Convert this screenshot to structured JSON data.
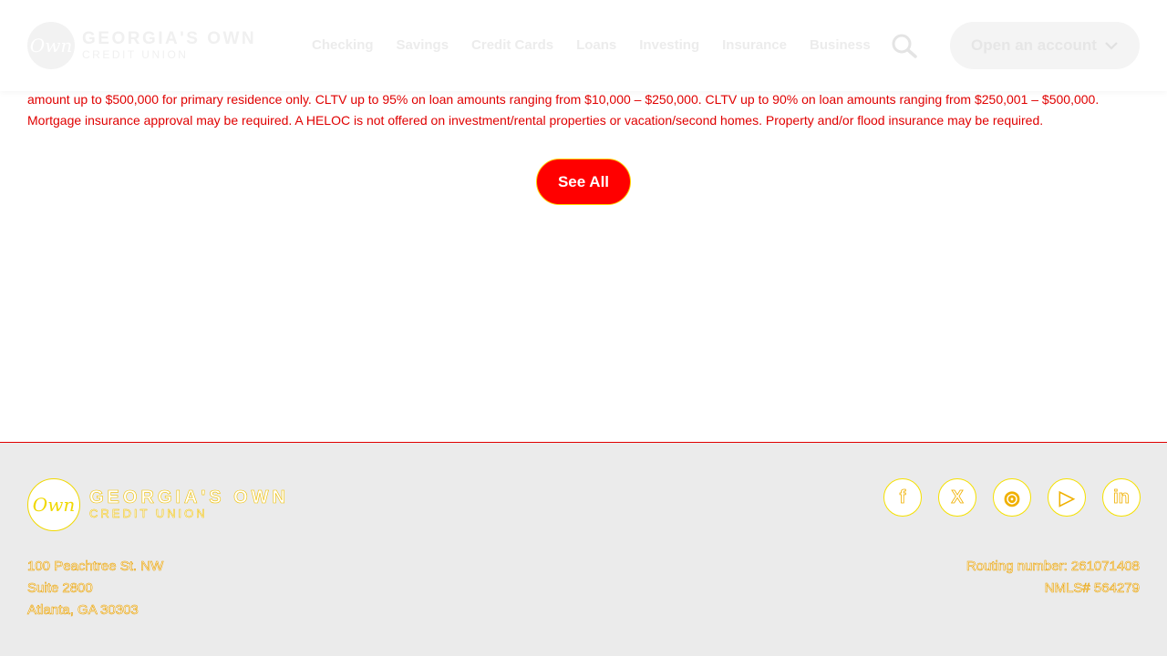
{
  "header": {
    "logo_mark": "Own",
    "logo_main": "GEORGIA'S OWN",
    "logo_sub": "CREDIT UNION",
    "nav": [
      "Checking",
      "Savings",
      "Credit Cards",
      "Loans",
      "Investing",
      "Insurance",
      "Business"
    ],
    "open_account_label": "Open an account",
    "search_icon": "search-icon",
    "chevron_icon": "chevron-down-icon"
  },
  "disclaimer": {
    "text": "amount up to $500,000 for primary residence only. CLTV up to 95% on loan amounts ranging from $10,000 – $250,000. CLTV up to 90% on loan amounts ranging from $250,001 – $500,000. Mortgage insurance approval may be required. A HELOC is not offered on investment/rental properties or vacation/second homes. Property and/or flood insurance may be required."
  },
  "see_all_label": "See All",
  "footer": {
    "logo_mark": "Own",
    "logo_main": "GEORGIA'S OWN",
    "logo_sub": "CREDIT UNION",
    "social": [
      {
        "icon": "facebook-icon",
        "glyph": "f"
      },
      {
        "icon": "x-twitter-icon",
        "glyph": "X"
      },
      {
        "icon": "instagram-icon",
        "glyph": "◎"
      },
      {
        "icon": "youtube-icon",
        "glyph": "▶"
      },
      {
        "icon": "linkedin-icon",
        "glyph": "in"
      }
    ],
    "address_line1": "100 Peachtree St. NW",
    "address_line2": "Suite 2800",
    "address_line3": "Atlanta, GA 30303",
    "routing": "Routing number: 261071408",
    "nmls": "NMLS# 564279"
  },
  "colors": {
    "accent_red": "#ff0000",
    "footer_bg": "#ebebeb"
  }
}
